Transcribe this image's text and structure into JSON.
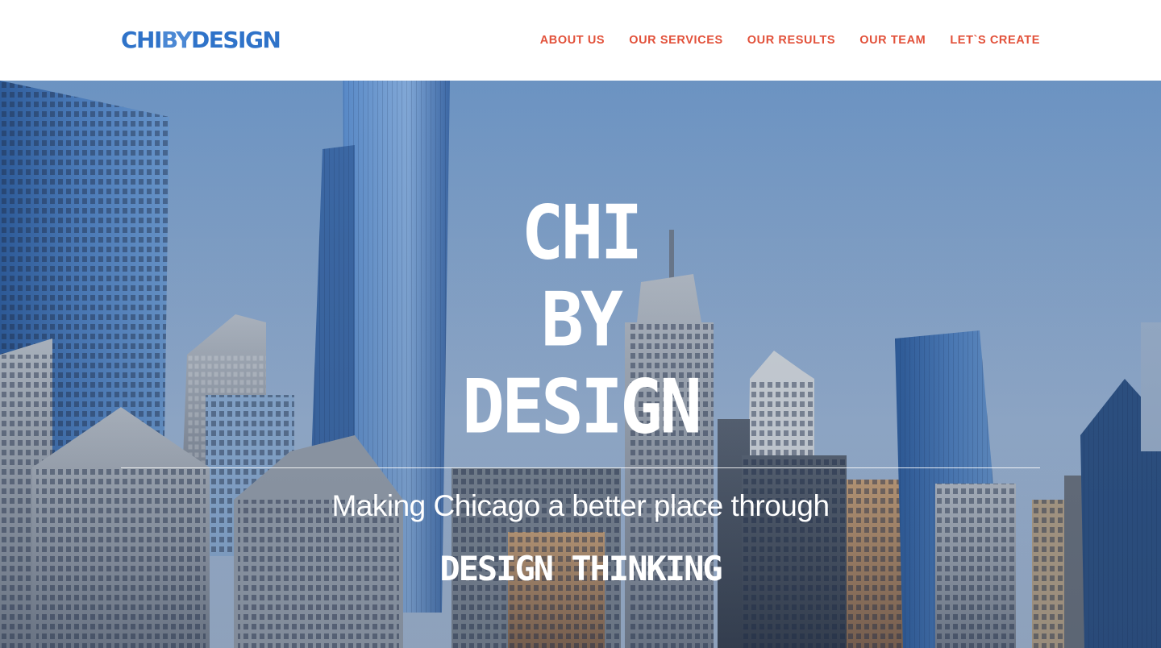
{
  "header": {
    "logo": {
      "part1": "CHI",
      "part2": "BY",
      "part3": "DESIGN"
    },
    "nav": [
      {
        "label": "ABOUT US"
      },
      {
        "label": "OUR SERVICES"
      },
      {
        "label": "OUR RESULTS"
      },
      {
        "label": "OUR TEAM"
      },
      {
        "label": "LET`S CREATE"
      }
    ]
  },
  "hero": {
    "title_line1": "CHI",
    "title_line2": "BY",
    "title_line3": "DESIGN",
    "tagline": "Making Chicago a better place through",
    "tagline_emphasis": "DESIGN THINKING",
    "background_image": "chicago-skyline"
  },
  "colors": {
    "brand_blue": "#2f73c9",
    "nav_accent": "#e2513a",
    "header_bg": "#ffffff",
    "hero_text": "#ffffff"
  }
}
